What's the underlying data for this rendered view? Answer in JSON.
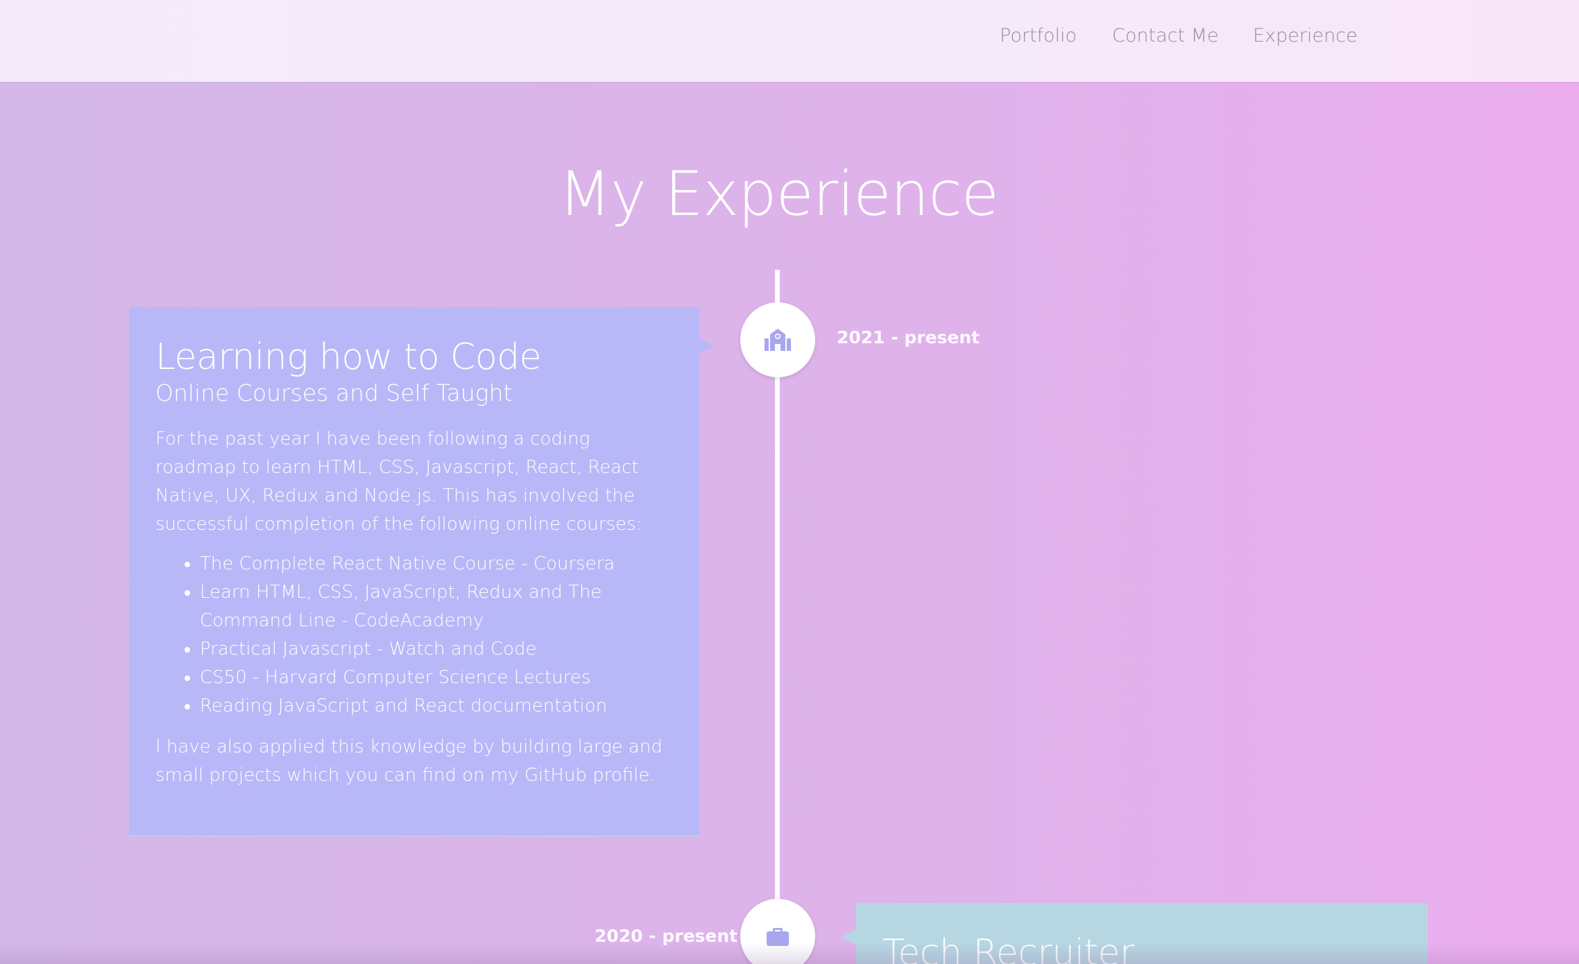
{
  "nav": {
    "links": [
      {
        "label": "Portfolio"
      },
      {
        "label": "Contact Me"
      },
      {
        "label": "Experience"
      }
    ]
  },
  "page": {
    "title": "My Experience"
  },
  "timeline": {
    "entries": [
      {
        "date": "2021 - present",
        "icon": "school-icon",
        "title": "Learning how to Code",
        "subtitle": "Online Courses and Self Taught",
        "intro": "For the past year I have been following a coding roadmap to learn HTML, CSS, Javascript, React, React Native, UX, Redux and Node.js. This has involved the successful completion of the following online courses:",
        "courses": [
          "The Complete React Native Course - Coursera",
          "Learn HTML, CSS, JavaScript, Redux and The Command Line - CodeAcademy",
          "Practical Javascript - Watch and Code",
          "CS50 - Harvard Computer Science Lectures",
          "Reading JavaScript and React documentation"
        ],
        "outro": "I have also applied this knowledge by building large and small projects which you can find on my GitHub profile.",
        "card_color": "#b8b8f8"
      },
      {
        "date": "2020 - present",
        "icon": "briefcase-icon",
        "title": "Tech Recruiter",
        "card_color": "#b6d6e2"
      }
    ]
  },
  "colors": {
    "icon_color": "#a9a6ee",
    "nav_text": "#9a8aa6"
  }
}
